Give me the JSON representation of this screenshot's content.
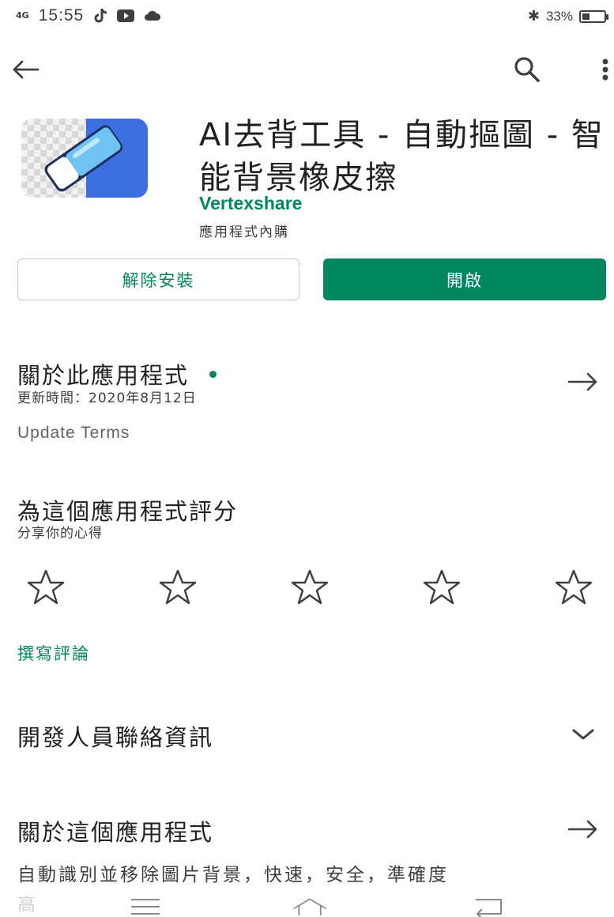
{
  "status_bar": {
    "signal": "4G",
    "time": "15:55",
    "icons": [
      "tiktok-icon",
      "youtube-icon",
      "cloud-icon"
    ],
    "bluetooth": "✱",
    "battery_text": "33%",
    "battery_level": 0.33
  },
  "top_bar": {
    "icons": [
      "back-arrow-icon",
      "search-icon",
      "more-vert-icon"
    ]
  },
  "app": {
    "title": "AI去背工具 - 自動摳圖 - 智能背景橡皮擦",
    "developer": "Vertexshare",
    "in_app_purchases": "應用程式內購",
    "accent_color": "#01875f"
  },
  "buttons": {
    "uninstall": "解除安裝",
    "open": "開啟"
  },
  "about_section": {
    "title": "關於此應用程式",
    "updated": "更新時間：2020年8月12日",
    "update_terms": "Update Terms"
  },
  "rate_section": {
    "title": "為這個應用程式評分",
    "subtitle": "分享你的心得",
    "star_count": 5,
    "write_review": "撰寫評論"
  },
  "developer_contact": {
    "title": "開發人員聯絡資訊"
  },
  "about_app": {
    "title": "關於這個應用程式",
    "description": "自動識別並移除圖片背景，快速，安全，準確度",
    "description_cont": "高"
  },
  "nav_bar": {
    "icons": [
      "menu-icon",
      "home-icon",
      "back-icon"
    ]
  }
}
